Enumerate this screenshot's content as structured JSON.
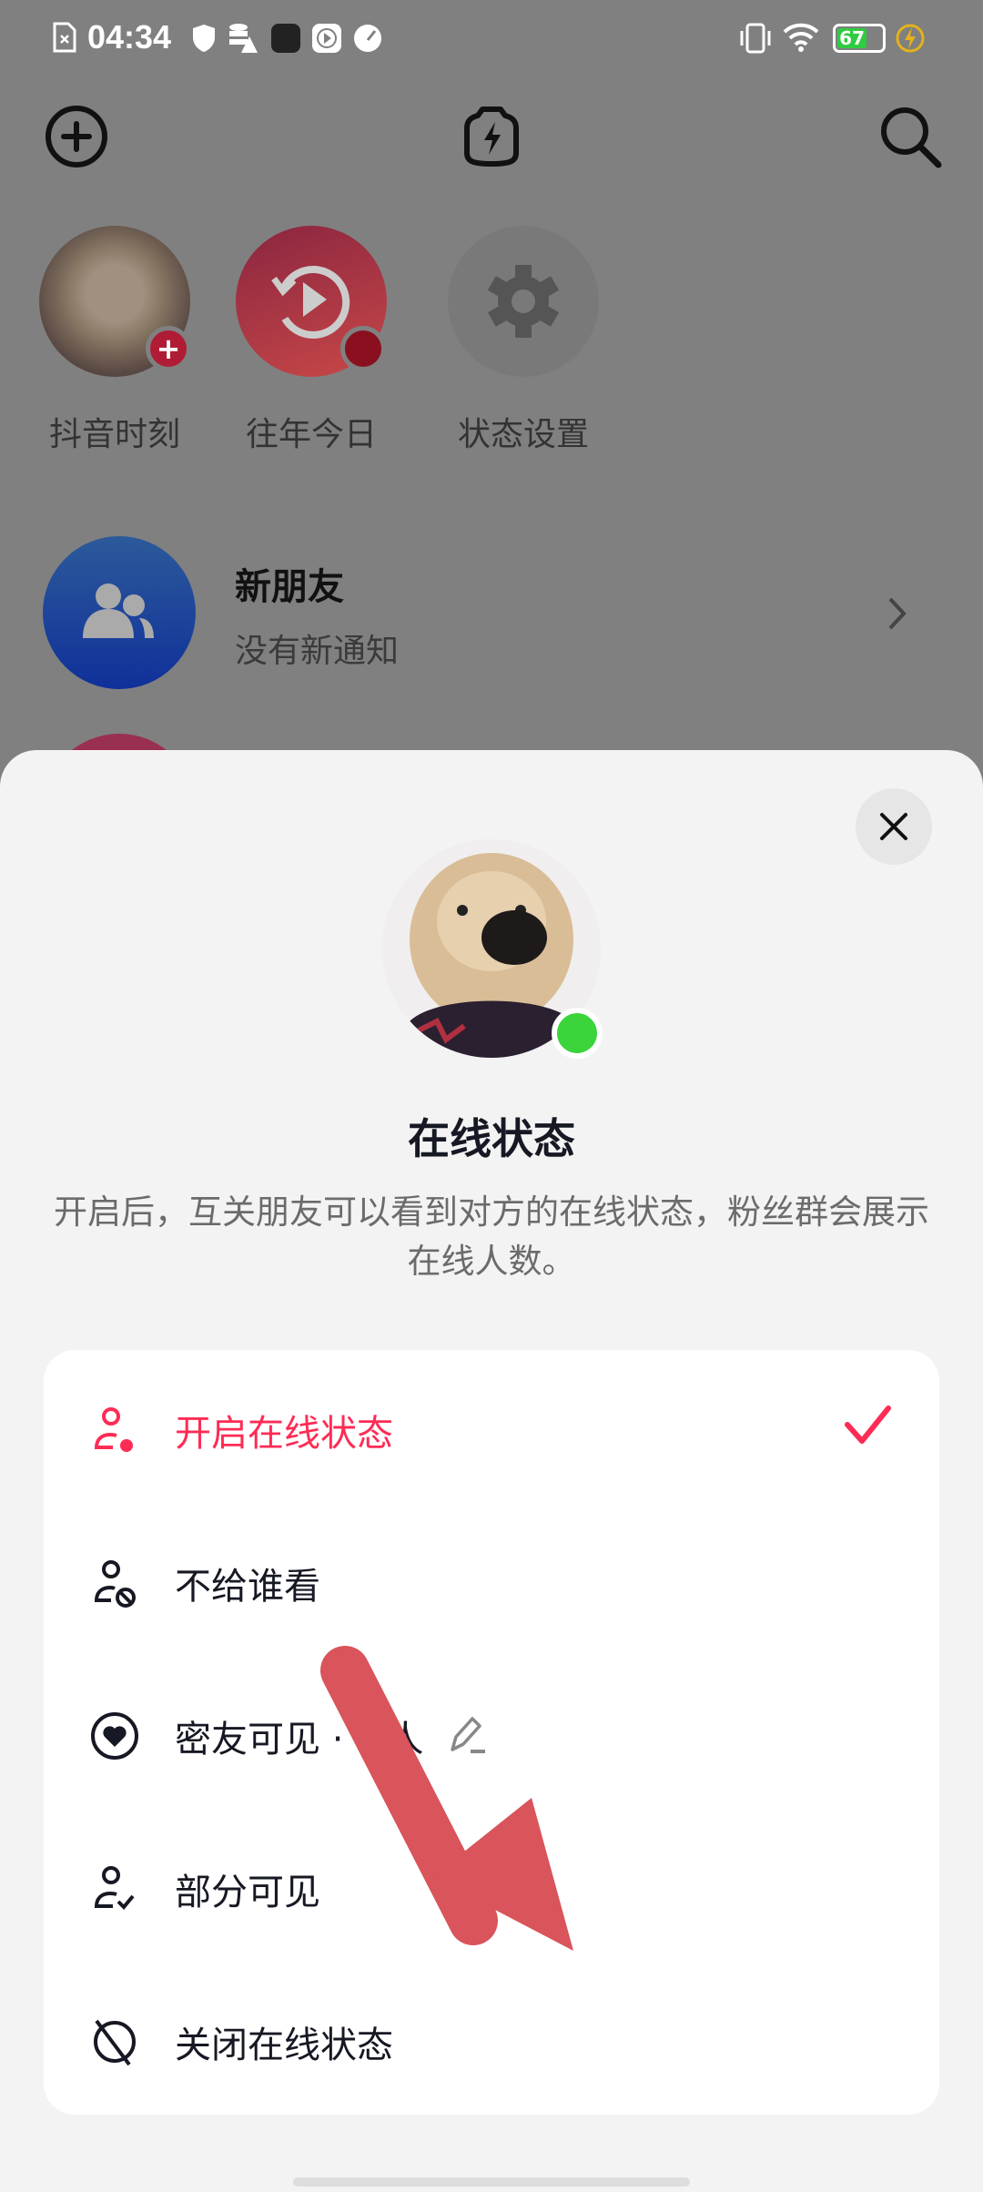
{
  "status_bar": {
    "time": "04:34",
    "battery": "67",
    "icons": [
      "sim-x-icon",
      "shield-icon",
      "data-warning-icon",
      "soul-app-icon",
      "play-icon",
      "speed-icon",
      "vibrate-icon",
      "wifi-icon",
      "battery-icon",
      "charging-icon"
    ]
  },
  "top_bar": {
    "icons": [
      "add-icon",
      "flash-camera-icon",
      "search-icon"
    ]
  },
  "stories": [
    {
      "label": "抖音时刻"
    },
    {
      "label": "往年今日"
    },
    {
      "label": "状态设置"
    }
  ],
  "new_friends": {
    "title": "新朋友",
    "subtitle": "没有新通知"
  },
  "sheet": {
    "title": "在线状态",
    "description": "开启后，互关朋友可以看到对方的在线状态，粉丝群会展示在线人数。",
    "options": [
      {
        "label": "开启在线状态",
        "selected": true,
        "icon": "person-online-icon"
      },
      {
        "label": "不给谁看",
        "icon": "person-block-icon"
      },
      {
        "label_prefix": "密友可见 ·",
        "label_suffix": "人",
        "icon": "heart-circle-icon",
        "action_icon": "edit-icon"
      },
      {
        "label": "部分可见",
        "icon": "person-check-icon"
      },
      {
        "label": "关闭在线状态",
        "icon": "offline-icon"
      }
    ]
  },
  "colors": {
    "accent": "#fe2c55",
    "online": "#3bd43b",
    "annotation_arrow": "#d9545b"
  }
}
